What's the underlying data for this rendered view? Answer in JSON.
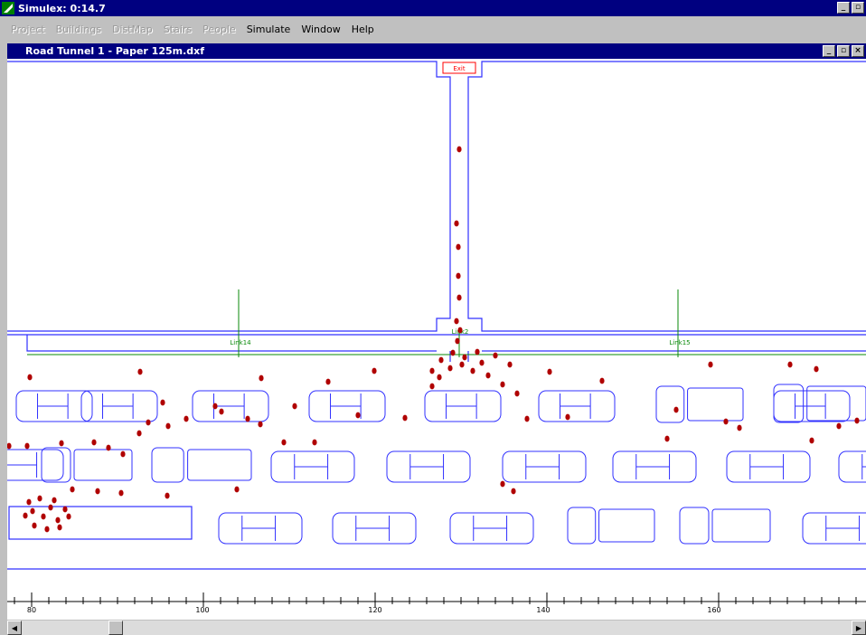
{
  "app": {
    "title": "Simulex: 0:14.7",
    "window_buttons": [
      "_",
      "▫"
    ]
  },
  "menu": [
    {
      "label": "Project",
      "enabled": false
    },
    {
      "label": "Buildings",
      "enabled": false
    },
    {
      "label": "DistMap",
      "enabled": false
    },
    {
      "label": "Stairs",
      "enabled": false
    },
    {
      "label": "People",
      "enabled": false
    },
    {
      "label": "Simulate",
      "enabled": true
    },
    {
      "label": "Window",
      "enabled": true
    },
    {
      "label": "Help",
      "enabled": true
    }
  ],
  "document": {
    "title": "Road Tunnel 1 - Paper 125m.dxf",
    "window_buttons": [
      "_",
      "▫",
      "×"
    ]
  },
  "plan": {
    "exit_label": "Exit",
    "link_labels": [
      "Link14",
      "Link2",
      "Link15"
    ],
    "line_color": "#3030ff",
    "link_color": "#0a8a0a",
    "person_color": "#b00000",
    "exit_color": "#ff0000",
    "ruler_labels": [
      "80",
      "100",
      "120",
      "140",
      "160"
    ]
  },
  "scrollbar": {
    "left_arrow": "◀",
    "right_arrow": "▶"
  }
}
